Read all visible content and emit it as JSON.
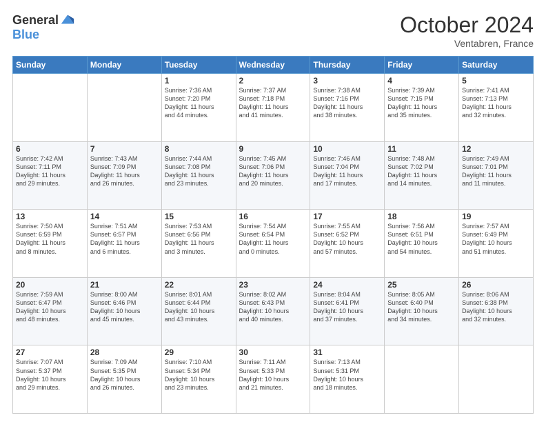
{
  "header": {
    "logo_general": "General",
    "logo_blue": "Blue",
    "month": "October 2024",
    "location": "Ventabren, France"
  },
  "weekdays": [
    "Sunday",
    "Monday",
    "Tuesday",
    "Wednesday",
    "Thursday",
    "Friday",
    "Saturday"
  ],
  "weeks": [
    [
      {
        "day": null
      },
      {
        "day": null
      },
      {
        "day": "1",
        "sunrise": "7:36 AM",
        "sunset": "7:20 PM",
        "daylight": "11 hours and 44 minutes."
      },
      {
        "day": "2",
        "sunrise": "7:37 AM",
        "sunset": "7:18 PM",
        "daylight": "11 hours and 41 minutes."
      },
      {
        "day": "3",
        "sunrise": "7:38 AM",
        "sunset": "7:16 PM",
        "daylight": "11 hours and 38 minutes."
      },
      {
        "day": "4",
        "sunrise": "7:39 AM",
        "sunset": "7:15 PM",
        "daylight": "11 hours and 35 minutes."
      },
      {
        "day": "5",
        "sunrise": "7:41 AM",
        "sunset": "7:13 PM",
        "daylight": "11 hours and 32 minutes."
      }
    ],
    [
      {
        "day": "6",
        "sunrise": "7:42 AM",
        "sunset": "7:11 PM",
        "daylight": "11 hours and 29 minutes."
      },
      {
        "day": "7",
        "sunrise": "7:43 AM",
        "sunset": "7:09 PM",
        "daylight": "11 hours and 26 minutes."
      },
      {
        "day": "8",
        "sunrise": "7:44 AM",
        "sunset": "7:08 PM",
        "daylight": "11 hours and 23 minutes."
      },
      {
        "day": "9",
        "sunrise": "7:45 AM",
        "sunset": "7:06 PM",
        "daylight": "11 hours and 20 minutes."
      },
      {
        "day": "10",
        "sunrise": "7:46 AM",
        "sunset": "7:04 PM",
        "daylight": "11 hours and 17 minutes."
      },
      {
        "day": "11",
        "sunrise": "7:48 AM",
        "sunset": "7:02 PM",
        "daylight": "11 hours and 14 minutes."
      },
      {
        "day": "12",
        "sunrise": "7:49 AM",
        "sunset": "7:01 PM",
        "daylight": "11 hours and 11 minutes."
      }
    ],
    [
      {
        "day": "13",
        "sunrise": "7:50 AM",
        "sunset": "6:59 PM",
        "daylight": "11 hours and 8 minutes."
      },
      {
        "day": "14",
        "sunrise": "7:51 AM",
        "sunset": "6:57 PM",
        "daylight": "11 hours and 6 minutes."
      },
      {
        "day": "15",
        "sunrise": "7:53 AM",
        "sunset": "6:56 PM",
        "daylight": "11 hours and 3 minutes."
      },
      {
        "day": "16",
        "sunrise": "7:54 AM",
        "sunset": "6:54 PM",
        "daylight": "11 hours and 0 minutes."
      },
      {
        "day": "17",
        "sunrise": "7:55 AM",
        "sunset": "6:52 PM",
        "daylight": "10 hours and 57 minutes."
      },
      {
        "day": "18",
        "sunrise": "7:56 AM",
        "sunset": "6:51 PM",
        "daylight": "10 hours and 54 minutes."
      },
      {
        "day": "19",
        "sunrise": "7:57 AM",
        "sunset": "6:49 PM",
        "daylight": "10 hours and 51 minutes."
      }
    ],
    [
      {
        "day": "20",
        "sunrise": "7:59 AM",
        "sunset": "6:47 PM",
        "daylight": "10 hours and 48 minutes."
      },
      {
        "day": "21",
        "sunrise": "8:00 AM",
        "sunset": "6:46 PM",
        "daylight": "10 hours and 45 minutes."
      },
      {
        "day": "22",
        "sunrise": "8:01 AM",
        "sunset": "6:44 PM",
        "daylight": "10 hours and 43 minutes."
      },
      {
        "day": "23",
        "sunrise": "8:02 AM",
        "sunset": "6:43 PM",
        "daylight": "10 hours and 40 minutes."
      },
      {
        "day": "24",
        "sunrise": "8:04 AM",
        "sunset": "6:41 PM",
        "daylight": "10 hours and 37 minutes."
      },
      {
        "day": "25",
        "sunrise": "8:05 AM",
        "sunset": "6:40 PM",
        "daylight": "10 hours and 34 minutes."
      },
      {
        "day": "26",
        "sunrise": "8:06 AM",
        "sunset": "6:38 PM",
        "daylight": "10 hours and 32 minutes."
      }
    ],
    [
      {
        "day": "27",
        "sunrise": "7:07 AM",
        "sunset": "5:37 PM",
        "daylight": "10 hours and 29 minutes."
      },
      {
        "day": "28",
        "sunrise": "7:09 AM",
        "sunset": "5:35 PM",
        "daylight": "10 hours and 26 minutes."
      },
      {
        "day": "29",
        "sunrise": "7:10 AM",
        "sunset": "5:34 PM",
        "daylight": "10 hours and 23 minutes."
      },
      {
        "day": "30",
        "sunrise": "7:11 AM",
        "sunset": "5:33 PM",
        "daylight": "10 hours and 21 minutes."
      },
      {
        "day": "31",
        "sunrise": "7:13 AM",
        "sunset": "5:31 PM",
        "daylight": "10 hours and 18 minutes."
      },
      {
        "day": null
      },
      {
        "day": null
      }
    ]
  ],
  "labels": {
    "sunrise": "Sunrise:",
    "sunset": "Sunset:",
    "daylight": "Daylight:"
  }
}
